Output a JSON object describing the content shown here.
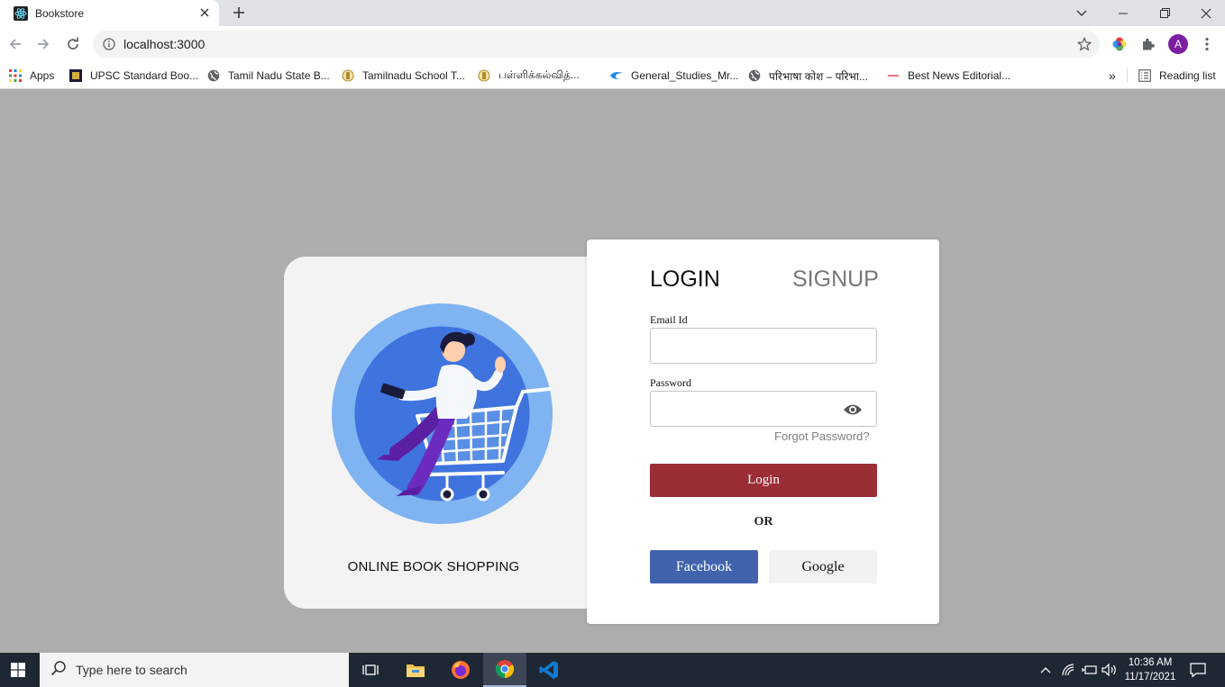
{
  "browser": {
    "tab_title": "Bookstore",
    "url": "localhost:3000",
    "avatar_letter": "A",
    "bookmarks": [
      {
        "label": "Apps"
      },
      {
        "label": "UPSC Standard Boo..."
      },
      {
        "label": "Tamil Nadu State B..."
      },
      {
        "label": "Tamilnadu School T..."
      },
      {
        "label": "பள்ளிக்கல்வித்..."
      },
      {
        "label": "General_Studies_Mr..."
      },
      {
        "label": "परिभाषा कोश – परिभा..."
      },
      {
        "label": "Best News Editorial..."
      }
    ],
    "overflow_label": "»",
    "reading_list": "Reading list"
  },
  "left_panel": {
    "tagline": "ONLINE BOOK SHOPPING"
  },
  "auth": {
    "tab_login": "LOGIN",
    "tab_signup": "SIGNUP",
    "email_label": "Email Id",
    "email_value": "",
    "password_label": "Password",
    "password_value": "",
    "forgot": "Forgot Password?",
    "login_button": "Login",
    "or_text": "OR",
    "facebook_button": "Facebook",
    "google_button": "Google"
  },
  "taskbar": {
    "search_placeholder": "Type here to search",
    "time": "10:36 AM",
    "date": "11/17/2021"
  },
  "colors": {
    "page_bg": "#adadad",
    "login_button": "#9b2d35",
    "facebook_button": "#4163ae",
    "google_button": "#f2f2f2",
    "illustration_circle": "#3f73de"
  }
}
